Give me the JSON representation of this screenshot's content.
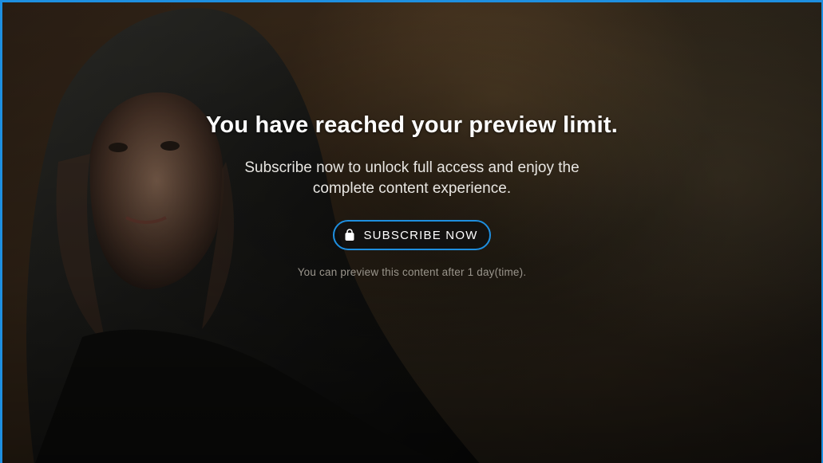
{
  "overlay": {
    "title": "You have reached your preview limit.",
    "subtitle": "Subscribe now to unlock full access and enjoy the complete content experience.",
    "subscribe_button_label": "SUBSCRIBE NOW",
    "subscribe_button_icon": "shopping-bag-icon",
    "preview_note": "You can preview this content after 1 day(time)."
  },
  "colors": {
    "accent": "#1e8fe0",
    "text_primary": "#ffffff",
    "text_muted": "#9a958c"
  }
}
